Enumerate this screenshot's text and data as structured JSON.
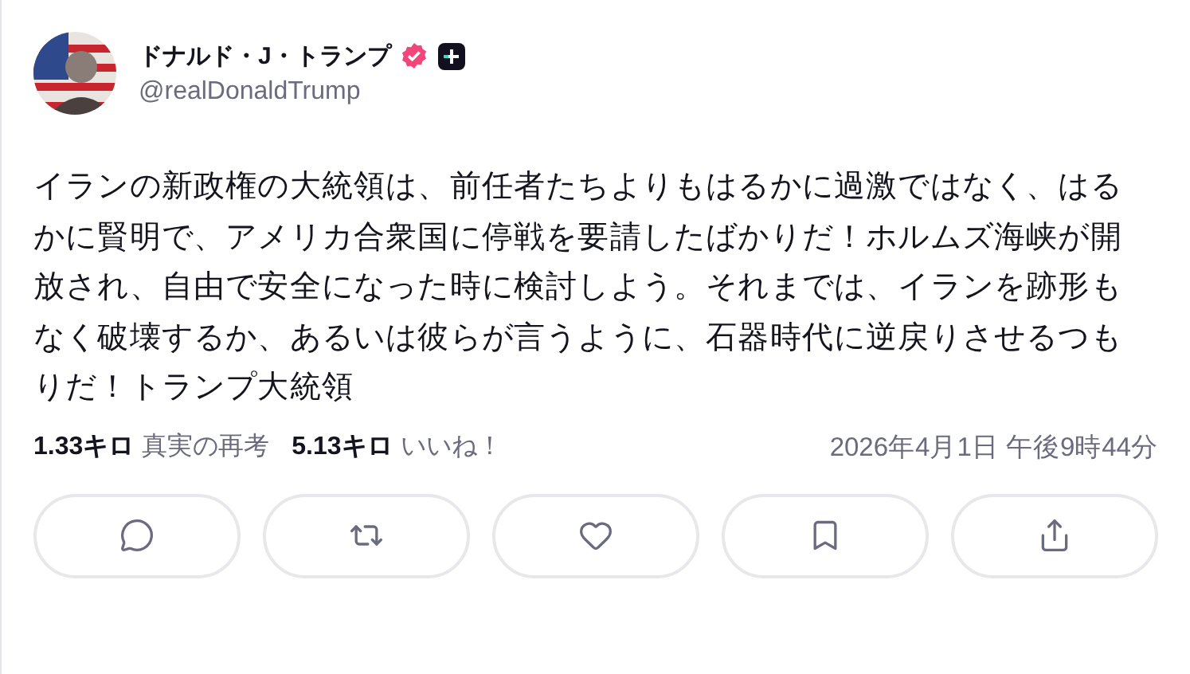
{
  "author": {
    "name": "ドナルド・J・トランプ",
    "handle": "@realDonaldTrump",
    "verified": true
  },
  "post": {
    "text": "イランの新政権の大統領は、前任者たちよりもはるかに過激ではなく、はるかに賢明で、アメリカ合衆国に停戦を要請したばかりだ！ホルムズ海峡が開放され、自由で安全になった時に検討しよう。それまでは、イランを跡形もなく破壊するか、あるいは彼らが言うように、石器時代に逆戻りさせるつもりだ！トランプ大統領"
  },
  "stats": [
    {
      "count": "1.33キロ",
      "label": "真実の再考"
    },
    {
      "count": "5.13キロ",
      "label": "いいね！"
    }
  ],
  "timestamp": "2026年4月1日 午後9時44分",
  "actions": [
    {
      "kind": "reply"
    },
    {
      "kind": "repost"
    },
    {
      "kind": "like"
    },
    {
      "kind": "bookmark"
    },
    {
      "kind": "share"
    }
  ]
}
